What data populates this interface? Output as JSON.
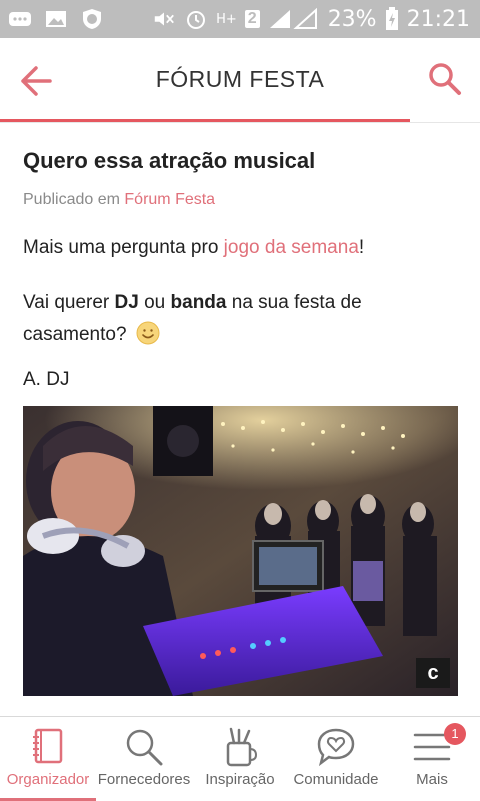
{
  "status_bar": {
    "battery_percent": "23%",
    "time": "21:21",
    "sim_indicator": "2",
    "network_type": "H+",
    "icons": [
      "message-icon",
      "image-icon",
      "shield-icon",
      "mute-icon",
      "alarm-icon",
      "signal-icon",
      "battery-charging-icon"
    ]
  },
  "app_bar": {
    "title": "FÓRUM FESTA",
    "back_icon": "arrow-left-icon",
    "search_icon": "search-icon",
    "progress": 0.855
  },
  "post": {
    "title": "Quero essa atração musical",
    "meta_prefix": "Publicado em ",
    "meta_link": "Fórum Festa",
    "p1_prefix": "Mais uma pergunta pro ",
    "p1_link": "jogo da semana",
    "p1_suffix": "!",
    "p2_a": "Vai querer ",
    "p2_b": "DJ",
    "p2_c": " ou ",
    "p2_d": "banda",
    "p2_e": " na sua festa de casamento?",
    "emoji": "smile-emoji",
    "option_a": "A. DJ",
    "photo": "dj-mixing-at-party-photo",
    "photo_badge_letter": "c"
  },
  "bottom_nav": {
    "items": [
      {
        "label": "Organizador",
        "icon": "notebook-icon",
        "active": true
      },
      {
        "label": "Fornecedores",
        "icon": "search-icon",
        "active": false
      },
      {
        "label": "Inspiração",
        "icon": "brush-jar-icon",
        "active": false
      },
      {
        "label": "Comunidade",
        "icon": "heart-chat-icon",
        "active": false
      },
      {
        "label": "Mais",
        "icon": "menu-icon",
        "active": false,
        "badge": "1"
      }
    ]
  },
  "colors": {
    "accent": "#e0707a",
    "accent_strong": "#e5575f",
    "status_bar": "#bdbdbd"
  }
}
